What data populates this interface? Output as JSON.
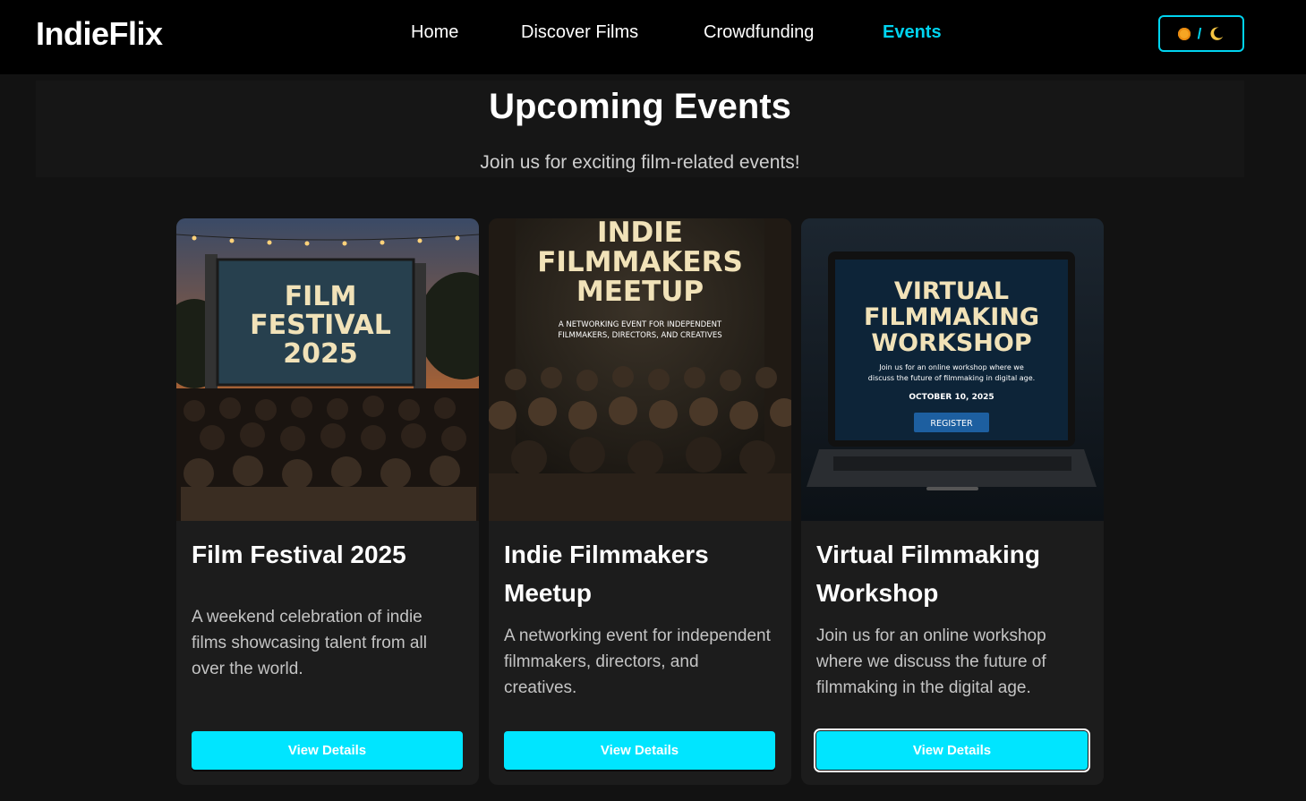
{
  "navbar": {
    "logo": "IndieFlix",
    "links": [
      {
        "label": "Home"
      },
      {
        "label": "Discover Films"
      },
      {
        "label": "Crowdfunding"
      },
      {
        "label": "Events"
      }
    ],
    "active_link": "Events",
    "theme_toggle": {
      "separator": "/",
      "icons": [
        "sun-icon",
        "moon-icon"
      ]
    }
  },
  "hero": {
    "title": "Upcoming Events",
    "subtitle": "Join us for exciting film-related events!"
  },
  "events": [
    {
      "title": "Film Festival 2025",
      "description": "A weekend celebration of indie films showcasing talent from all over the world.",
      "button_label": "View Details",
      "poster": {
        "lines": [
          "FILM",
          "FESTIVAL",
          "2025"
        ]
      }
    },
    {
      "title": "Indie Filmmakers Meetup",
      "description": "A networking event for independent filmmakers, directors, and creatives.",
      "button_label": "View Details",
      "poster": {
        "lines": [
          "INDIE",
          "FILMMAKERS",
          "MEETUP"
        ],
        "tagline_1": "A NETWORKING EVENT FOR INDEPENDENT",
        "tagline_2": "FILMMAKERS, DIRECTORS, AND CREATIVES"
      }
    },
    {
      "title": "Virtual Filmmaking Workshop",
      "description": "Join us for an online workshop where we discuss the future of filmmaking in the digital age.",
      "button_label": "View Details",
      "poster": {
        "lines": [
          "VIRTUAL",
          "FILMMAKING",
          "WORKSHOP"
        ],
        "sub_1": "Join us for an online workshop where we",
        "sub_2": "discuss the future of filmmaking in digital age.",
        "date": "OCTOBER 10, 2025",
        "cta": "REGISTER"
      }
    }
  ],
  "colors": {
    "accent": "#00e5ff",
    "active_nav": "#00d4f0",
    "background": "#121212",
    "card": "#1c1c1c"
  }
}
